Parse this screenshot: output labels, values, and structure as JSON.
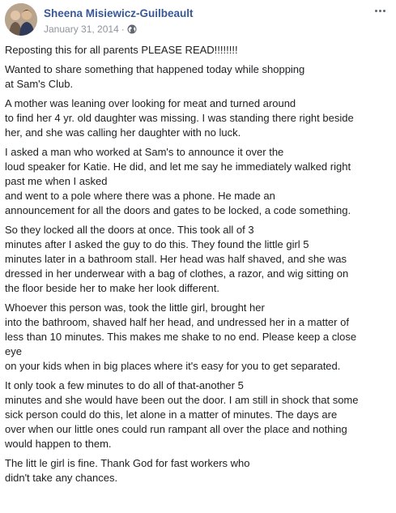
{
  "post": {
    "author": "Sheena Misiewicz-Guilbeault",
    "date": "January 31, 2014",
    "separator": "·",
    "privacy_icon": "globe-icon",
    "more_icon": "more-options-icon",
    "paragraphs": [
      "Reposting this for all parents PLEASE READ!!!!!!!!",
      "Wanted to share something that happened today while shopping\nat Sam's Club.",
      "A mother was leaning over looking for meat and turned around\nto find her 4 yr. old daughter was missing. I was standing there right beside\nher, and she was calling her daughter with no luck.",
      "I asked a man who worked at Sam's to announce it over the\nloud speaker for Katie. He did, and let me say he immediately walked right\npast me when I asked\nand went to a pole where there was a phone. He made an\nannouncement for all the doors and gates to be locked, a code something.",
      "So they locked all the doors at once. This took all of 3\nminutes after I asked the guy to do this. They found the little girl 5\nminutes later in a bathroom stall. Her head was half shaved, and she was\ndressed in her underwear with a bag of clothes, a razor, and wig sitting on\nthe floor beside her to make her look different.",
      "Whoever this person was, took the little girl, brought her\ninto the bathroom, shaved half her head, and undressed her in a matter of\nless than 10 minutes. This makes me shake to no end. Please keep a close\neye\non your kids when in big places where it's easy for you to get separated.",
      "It only took a few minutes to do all of that-another 5\nminutes and she would have been out the door. I am still in shock that some\nsick person could do this, let alone in a matter of minutes. The days are\nover when our little ones could run rampant all over the place and nothing\nwould happen to them.",
      "The litt le girl is fine. Thank God for fast workers who\ndidn't take any chances."
    ]
  },
  "colors": {
    "author_link": "#385898",
    "meta_text": "#90949c",
    "body_text": "#1c1e21"
  }
}
